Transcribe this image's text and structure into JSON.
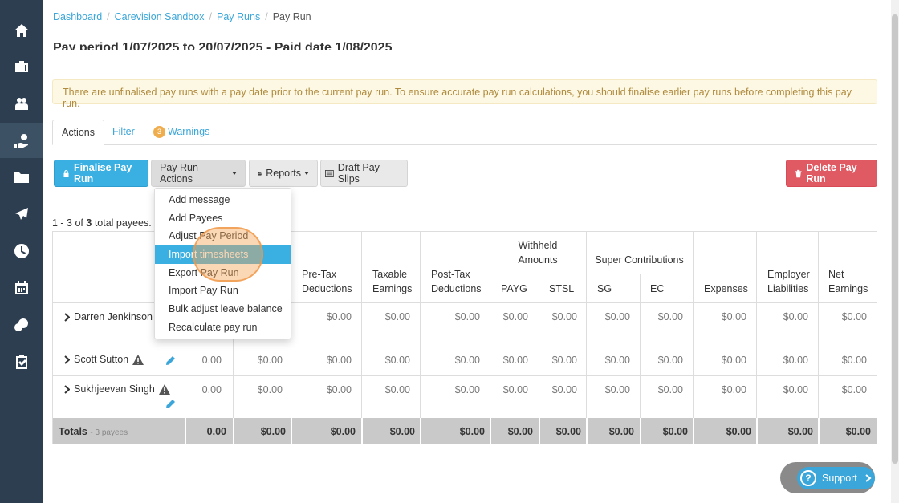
{
  "breadcrumb": {
    "dashboard": "Dashboard",
    "sandbox": "Carevision Sandbox",
    "payruns": "Pay Runs",
    "current": "Pay Run",
    "sep": "/"
  },
  "page": {
    "title_partial": "Pay period 1/07/2025 to 20/07/2025 - Paid date 1/08/2025"
  },
  "alert": {
    "text": "There are unfinalised pay runs with a pay date prior to the current pay run. To ensure accurate pay run calculations, you should finalise earlier pay runs before completing this pay run."
  },
  "tabs": {
    "actions": "Actions",
    "filter": "Filter",
    "warnings_count": "3",
    "warnings": "Warnings"
  },
  "toolbar": {
    "finalise": "Finalise Pay Run",
    "actions": "Pay Run Actions",
    "reports": "Reports",
    "draft": "Draft Pay Slips",
    "delete": "Delete Pay Run"
  },
  "dropdown": {
    "items": [
      "Add message",
      "Add Payees",
      "Adjust Pay Period",
      "Import timesheets",
      "Export Pay Run",
      "Import Pay Run",
      "Bulk adjust leave balance",
      "Recalculate pay run"
    ]
  },
  "summary": {
    "prefix": "1 - 3 of ",
    "total": "3",
    "suffix": " total payees."
  },
  "table": {
    "headers": {
      "pretax_1": "Pre-Tax",
      "pretax_2": "Deductions",
      "taxable_1": "Taxable",
      "taxable_2": "Earnings",
      "posttax_1": "Post-Tax",
      "posttax_2": "Deductions",
      "withheld_1": "Withheld",
      "withheld_2": "Amounts",
      "payg": "PAYG",
      "stsl": "STSL",
      "super": "Super Contributions",
      "sg": "SG",
      "ec": "EC",
      "expenses": "Expenses",
      "employer_1": "Employer",
      "employer_2": "Liabilities",
      "net_1": "Net",
      "net_2": "Earnings"
    },
    "rows": [
      {
        "name": "Darren Jenkinson",
        "c1": "",
        "c2": "",
        "c3": "$0.00",
        "c4": "$0.00",
        "c5": "$0.00",
        "c6": "$0.00",
        "c7": "$0.00",
        "c8": "$0.00",
        "c9": "$0.00",
        "c10": "$0.00",
        "c11": "$0.00",
        "c12": "$0.00"
      },
      {
        "name": "Scott Sutton",
        "c1": "0.00",
        "c2": "$0.00",
        "c3": "$0.00",
        "c4": "$0.00",
        "c5": "$0.00",
        "c6": "$0.00",
        "c7": "$0.00",
        "c8": "$0.00",
        "c9": "$0.00",
        "c10": "$0.00",
        "c11": "$0.00",
        "c12": "$0.00"
      },
      {
        "name": "Sukhjeevan Singh",
        "c1": "0.00",
        "c2": "$0.00",
        "c3": "$0.00",
        "c4": "$0.00",
        "c5": "$0.00",
        "c6": "$0.00",
        "c7": "$0.00",
        "c8": "$0.00",
        "c9": "$0.00",
        "c10": "$0.00",
        "c11": "$0.00",
        "c12": "$0.00"
      }
    ],
    "totals": {
      "label": "Totals",
      "sub": "- 3 payees",
      "c1": "0.00",
      "c2": "$0.00",
      "c3": "$0.00",
      "c4": "$0.00",
      "c5": "$0.00",
      "c6": "$0.00",
      "c7": "$0.00",
      "c8": "$0.00",
      "c9": "$0.00",
      "c10": "$0.00",
      "c11": "$0.00",
      "c12": "$0.00"
    }
  },
  "support": {
    "label": "Support",
    "q": "?"
  }
}
